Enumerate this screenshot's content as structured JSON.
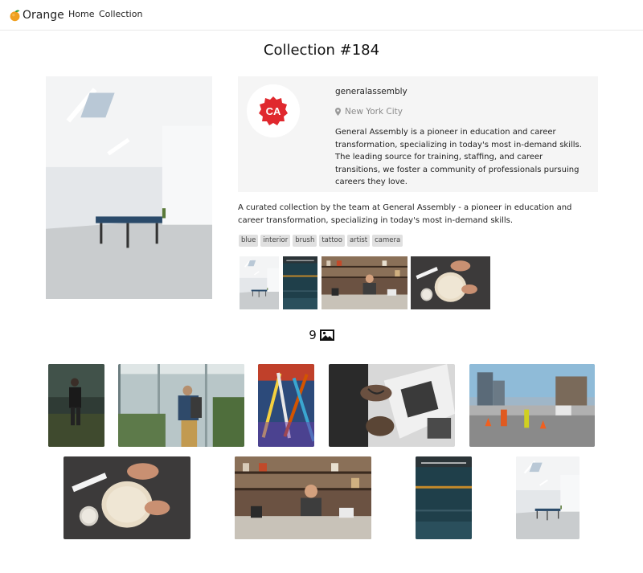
{
  "navbar": {
    "brand": "Orange",
    "links": [
      "Home",
      "Collection"
    ],
    "brand_icon": "orange-fruit-icon",
    "accent": "#f0a020"
  },
  "page": {
    "title": "Collection #184"
  },
  "user": {
    "username": "generalassembly",
    "avatar_text": "CA",
    "avatar_color": "#e0282e",
    "location": "New York City",
    "bio": "General Assembly is a pioneer in education and career transformation, specializing in today's most in-demand skills. The leading source for training, staffing, and career transitions, we foster a community of professionals pursuing careers they love."
  },
  "collection": {
    "description": "A curated collection by the team at General Assembly - a pioneer in education and career transformation, specializing in today's most in-demand skills.",
    "tags": [
      "blue",
      "interior",
      "brush",
      "tattoo",
      "artist",
      "camera"
    ],
    "photo_count": "9",
    "count_icon": "image-icon"
  },
  "preview_thumbs": [
    "white-room-ping-pong",
    "teal-shelves",
    "barista-coffee-bar",
    "pottery-dough"
  ],
  "gallery": [
    "hiker-forest",
    "greenhouse-backpacker",
    "paint-brushes",
    "tattoo-artist-book",
    "construction-street",
    "pottery-dough",
    "barista-coffee-bar",
    "teal-shelves",
    "white-room-ping-pong"
  ]
}
